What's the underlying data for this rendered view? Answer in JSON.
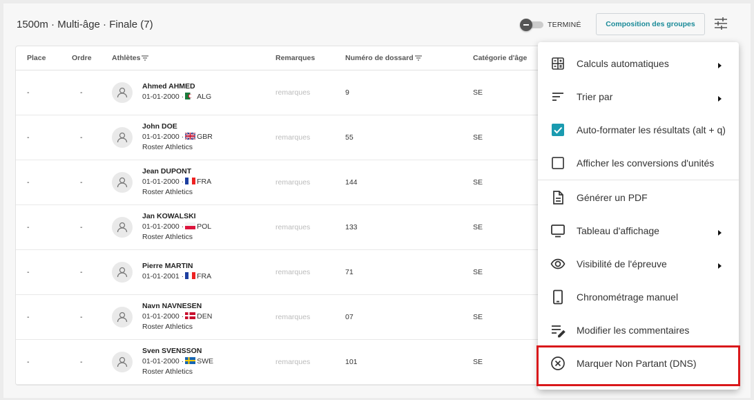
{
  "header": {
    "event_title": "1500m · Multi-âge · Finale (7)",
    "finished_label": "TERMINÉ",
    "groups_button": "Composition des groupes",
    "settings_icon": "sliders-icon"
  },
  "table": {
    "columns": {
      "place": "Place",
      "order": "Ordre",
      "athletes": "Athlètes",
      "remarks": "Remarques",
      "bib": "Numéro de dossard",
      "category": "Catégorie d'âge"
    },
    "rows": [
      {
        "place": "-",
        "order": "-",
        "name": "Ahmed AHMED",
        "dob": "01-01-2000 ·",
        "country": "ALG",
        "flag": "ALG",
        "club": "",
        "remark_placeholder": "remarques",
        "bib": "9",
        "category": "SE"
      },
      {
        "place": "-",
        "order": "-",
        "name": "John DOE",
        "dob": "01-01-2000 ·",
        "country": "GBR",
        "flag": "GBR",
        "club": "Roster Athletics",
        "remark_placeholder": "remarques",
        "bib": "55",
        "category": "SE"
      },
      {
        "place": "-",
        "order": "-",
        "name": "Jean DUPONT",
        "dob": "01-01-2000 ·",
        "country": "FRA",
        "flag": "FRA",
        "club": "Roster Athletics",
        "remark_placeholder": "remarques",
        "bib": "144",
        "category": "SE"
      },
      {
        "place": "-",
        "order": "-",
        "name": "Jan KOWALSKI",
        "dob": "01-01-2000 ·",
        "country": "POL",
        "flag": "POL",
        "club": "Roster Athletics",
        "remark_placeholder": "remarques",
        "bib": "133",
        "category": "SE"
      },
      {
        "place": "-",
        "order": "-",
        "name": "Pierre MARTIN",
        "dob": "01-01-2001 ·",
        "country": "FRA",
        "flag": "FRA",
        "club": "",
        "remark_placeholder": "remarques",
        "bib": "71",
        "category": "SE"
      },
      {
        "place": "-",
        "order": "-",
        "name": "Navn NAVNESEN",
        "dob": "01-01-2000 ·",
        "country": "DEN",
        "flag": "DEN",
        "club": "Roster Athletics",
        "remark_placeholder": "remarques",
        "bib": "07",
        "category": "SE"
      },
      {
        "place": "-",
        "order": "-",
        "name": "Sven SVENSSON",
        "dob": "01-01-2000 ·",
        "country": "SWE",
        "flag": "SWE",
        "club": "Roster Athletics",
        "remark_placeholder": "remarques",
        "bib": "101",
        "category": "SE"
      }
    ]
  },
  "menu": {
    "items": [
      {
        "label": "Calculs automatiques",
        "icon": "calculator-icon",
        "submenu": true
      },
      {
        "label": "Trier par",
        "icon": "sort-icon",
        "submenu": true
      },
      {
        "label": "Auto-formater les résultats (alt + q)",
        "icon": "checkbox-checked-icon",
        "submenu": false
      },
      {
        "label": "Afficher les conversions d'unités",
        "icon": "checkbox-empty-icon",
        "submenu": false
      },
      {
        "label": "Générer un PDF",
        "icon": "document-icon",
        "submenu": false
      },
      {
        "label": "Tableau d'affichage",
        "icon": "monitor-icon",
        "submenu": true
      },
      {
        "label": "Visibilité de l'épreuve",
        "icon": "eye-icon",
        "submenu": true
      },
      {
        "label": "Chronométrage manuel",
        "icon": "phone-icon",
        "submenu": false
      },
      {
        "label": "Modifier les commentaires",
        "icon": "edit-notes-icon",
        "submenu": false
      },
      {
        "label": "Marquer Non Partant (DNS)",
        "icon": "cancel-circle-icon",
        "submenu": false
      }
    ]
  },
  "colors": {
    "accent": "#1a8a98",
    "checkbox": "#1a9bb0",
    "highlight": "#d9181b"
  }
}
